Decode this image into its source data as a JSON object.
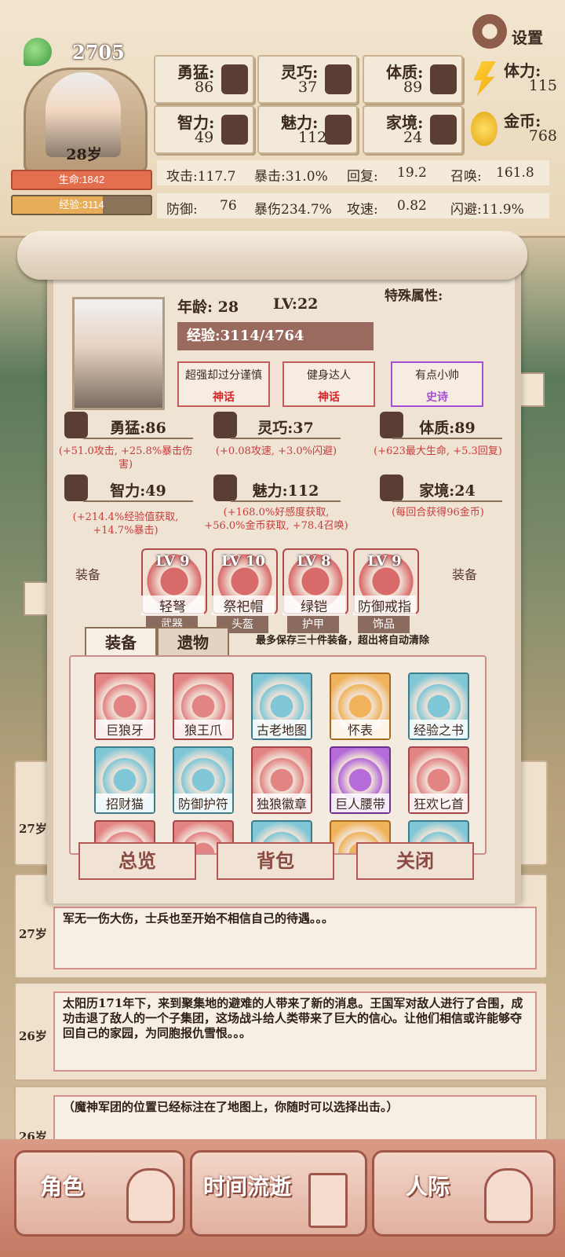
{
  "header": {
    "coin_count": "2705",
    "age": "28岁",
    "life": "生命:1842",
    "exp": "经验:3114",
    "exp_ratio": 0.654,
    "settings_label": "设置",
    "stats": [
      {
        "name": "勇猛:",
        "value": "86"
      },
      {
        "name": "灵巧:",
        "value": "37"
      },
      {
        "name": "体质:",
        "value": "89"
      },
      {
        "name": "智力:",
        "value": "49"
      },
      {
        "name": "魅力:",
        "value": "112"
      },
      {
        "name": "家境:",
        "value": "24"
      }
    ],
    "stamina": {
      "name": "体力:",
      "value": "115"
    },
    "gold": {
      "name": "金币:",
      "value": "768"
    },
    "battle": [
      {
        "label": "攻击:117.7"
      },
      {
        "label": "暴击:31.0%"
      },
      {
        "label": "回复:",
        "value": "19.2"
      },
      {
        "label": "召唤:",
        "value": "161.8"
      },
      {
        "label": "防御:",
        "value": "76"
      },
      {
        "label": "暴伤234.7%"
      },
      {
        "label": "攻速:",
        "value": "0.82"
      },
      {
        "label": "闪避:11.9%"
      }
    ]
  },
  "panel": {
    "age": "年龄: 28",
    "level": "LV:22",
    "special_label": "特殊属性:",
    "exp": "经验:3114/4764",
    "traits": [
      {
        "name": "超强却过分谨慎",
        "rarity": "神话"
      },
      {
        "name": "健身达人",
        "rarity": "神话"
      },
      {
        "name": "有点小帅",
        "rarity": "史诗"
      }
    ],
    "attributes": [
      {
        "title": "勇猛:86",
        "desc": "(+51.0攻击, +25.8%暴击伤害)"
      },
      {
        "title": "灵巧:37",
        "desc": "(+0.08攻速, +3.0%闪避)"
      },
      {
        "title": "体质:89",
        "desc": "(+623最大生命, +5.3回复)"
      },
      {
        "title": "智力:49",
        "desc": "(+214.4%经验值获取, +14.7%暴击)"
      },
      {
        "title": "魅力:112",
        "desc": "(+168.0%好感度获取, +56.0%金币获取, +78.4召唤)"
      },
      {
        "title": "家境:24",
        "desc": "(每回合获得96金币)"
      }
    ],
    "equip_label_left": "装备",
    "equip_label_right": "装备",
    "equipped": [
      {
        "level": "LV 9",
        "name": "轻弩",
        "type": "武器"
      },
      {
        "level": "LV 10",
        "name": "祭祀帽",
        "type": "头盔"
      },
      {
        "level": "LV 8",
        "name": "绿铠",
        "type": "护甲"
      },
      {
        "level": "LV 9",
        "name": "防御戒指",
        "type": "饰品"
      }
    ],
    "tabs": [
      "装备",
      "遗物"
    ],
    "note": "最多保存三十件装备，超出将自动清除",
    "inventory": [
      {
        "name": "巨狼牙"
      },
      {
        "name": "狼王爪"
      },
      {
        "name": "古老地图"
      },
      {
        "name": "怀表"
      },
      {
        "name": "经验之书"
      },
      {
        "name": "招财猫"
      },
      {
        "name": "防御护符"
      },
      {
        "name": "独狼徽章"
      },
      {
        "name": "巨人腰带"
      },
      {
        "name": "狂欢匕首"
      }
    ],
    "buttons": [
      "总览",
      "背包",
      "关闭"
    ]
  },
  "logs": [
    {
      "age": "27岁",
      "text": ""
    },
    {
      "age": "27岁",
      "text": "军无一伤大伤，士兵也至开始不相信自己的待遇。。。"
    },
    {
      "age": "26岁",
      "text": "太阳历171年下，来到聚集地的避难的人带来了新的消息。王国军对敌人进行了合围，成功击退了敌人的一个子集团，这场战斗给人类带来了巨大的信心。让他们相信或许能够夺回自己的家园，为同胞报仇雪恨。。。"
    },
    {
      "age": "26岁",
      "text": "（魔神军团的位置已经标注在了地图上，你随时可以选择出击。）"
    }
  ],
  "nav": [
    {
      "label": "角色"
    },
    {
      "label": "时间流逝"
    },
    {
      "label": "人际"
    }
  ]
}
